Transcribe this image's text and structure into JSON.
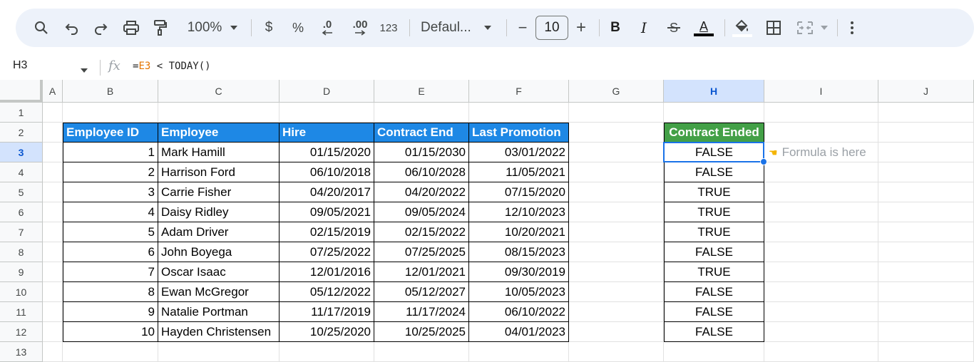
{
  "toolbar": {
    "zoom": "100%",
    "currency": "$",
    "percent": "%",
    "dec_decrease": ".0",
    "dec_increase": ".00",
    "number_format": "123",
    "font": "Defaul...",
    "minus": "−",
    "font_size": "10",
    "plus": "+",
    "bold": "B",
    "italic": "I",
    "text_color_letter": "A"
  },
  "formula_bar": {
    "name_box": "H3",
    "fx": "fx",
    "formula_prefix": "=",
    "formula_ref": "E3",
    "formula_rest": " < TODAY()"
  },
  "columns": [
    "A",
    "B",
    "C",
    "D",
    "E",
    "F",
    "G",
    "H",
    "I",
    "J"
  ],
  "rows": [
    "1",
    "2",
    "3",
    "4",
    "5",
    "6",
    "7",
    "8",
    "9",
    "10",
    "11",
    "12",
    "13"
  ],
  "table": {
    "headers": [
      "Employee ID",
      "Employee",
      "Hire",
      "Contract End",
      "Last Promotion"
    ],
    "rows": [
      [
        "1",
        "Mark Hamill",
        "01/15/2020",
        "01/15/2030",
        "03/01/2022"
      ],
      [
        "2",
        "Harrison Ford",
        "06/10/2018",
        "06/10/2028",
        "11/05/2021"
      ],
      [
        "3",
        "Carrie Fisher",
        "04/20/2017",
        "04/20/2022",
        "07/15/2020"
      ],
      [
        "4",
        "Daisy Ridley",
        "09/05/2021",
        "09/05/2024",
        "12/10/2023"
      ],
      [
        "5",
        "Adam Driver",
        "02/15/2019",
        "02/15/2022",
        "10/20/2021"
      ],
      [
        "6",
        "John Boyega",
        "07/25/2022",
        "07/25/2025",
        "08/15/2023"
      ],
      [
        "7",
        "Oscar Isaac",
        "12/01/2016",
        "12/01/2021",
        "09/30/2019"
      ],
      [
        "8",
        "Ewan McGregor",
        "05/12/2022",
        "05/12/2027",
        "10/05/2023"
      ],
      [
        "9",
        "Natalie Portman",
        "11/17/2019",
        "11/17/2024",
        "06/10/2022"
      ],
      [
        "10",
        "Hayden Christensen",
        "10/25/2020",
        "10/25/2025",
        "04/01/2023"
      ]
    ]
  },
  "result": {
    "header": "Contract Ended",
    "values": [
      "FALSE",
      "FALSE",
      "TRUE",
      "TRUE",
      "TRUE",
      "FALSE",
      "TRUE",
      "FALSE",
      "FALSE",
      "FALSE"
    ]
  },
  "note": {
    "text": "Formula is here",
    "icon": "pointing-hand-icon"
  },
  "colors": {
    "header_blue": "#1e88e5",
    "header_green": "#43a047",
    "selection": "#1a73e8"
  }
}
